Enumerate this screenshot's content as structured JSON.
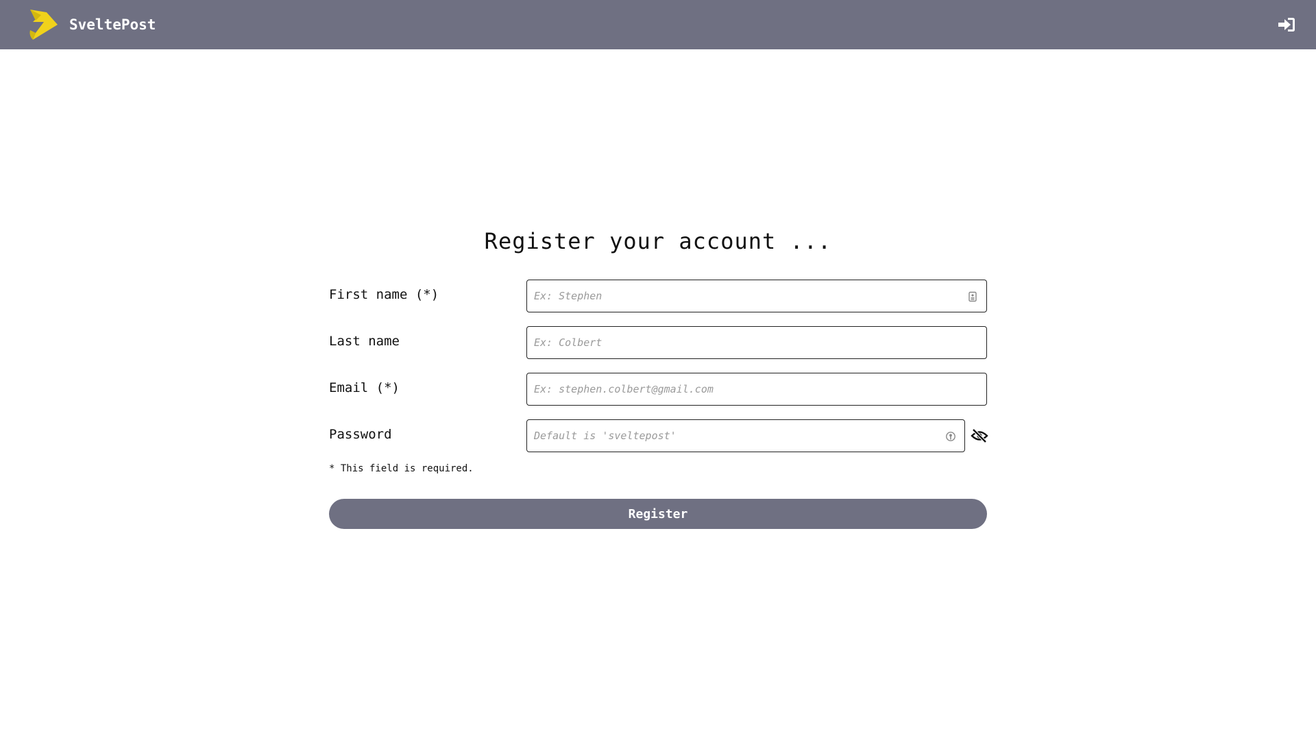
{
  "navbar": {
    "brand": "SveltePost",
    "logo_icon": "sveltepost-logo-icon",
    "login_icon": "sign-in-icon",
    "background_color": "#6f7082",
    "logo_color": "#f0d21b"
  },
  "main": {
    "title": "Register your account ..."
  },
  "form": {
    "first_name": {
      "label": "First name (*)",
      "placeholder": "Ex: Stephen",
      "icon": "contact-card-icon"
    },
    "last_name": {
      "label": "Last name",
      "placeholder": "Ex: Colbert"
    },
    "email": {
      "label": "Email (*)",
      "placeholder": "Ex: stephen.colbert@gmail.com"
    },
    "password": {
      "label": "Password",
      "placeholder": "Default is 'sveltepost'",
      "icon": "key-icon",
      "toggle_icon": "eye-slash-icon"
    },
    "required_note": "* This field is required.",
    "submit_label": "Register",
    "button_color": "#6f7082"
  }
}
